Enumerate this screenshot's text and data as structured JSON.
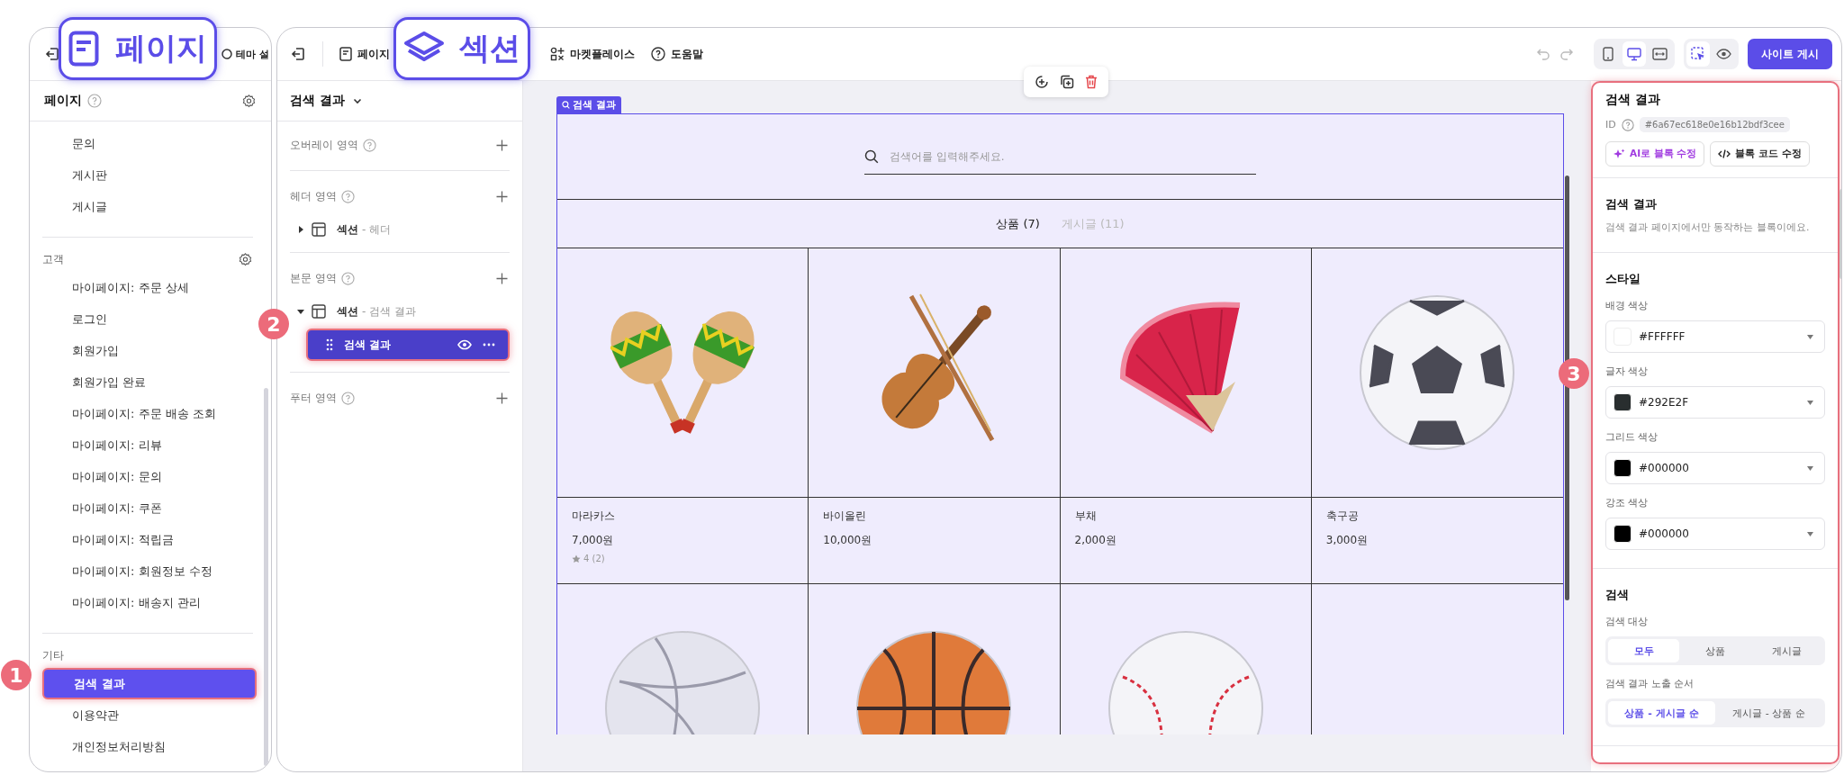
{
  "callouts": [
    {
      "kind": "page",
      "label": "페이지"
    },
    {
      "kind": "layers",
      "label": "섹션"
    }
  ],
  "markers": [
    "1",
    "2",
    "3"
  ],
  "pages_panel": {
    "toolbar_text": "테마 설",
    "title": "페이지",
    "groups": [
      {
        "items": [
          {
            "label": "문의",
            "selected": false
          },
          {
            "label": "게시판",
            "selected": false
          },
          {
            "label": "게시글",
            "selected": false
          }
        ]
      },
      {
        "title": "고객",
        "has_settings": true,
        "items": [
          {
            "label": "마이페이지: 주문 상세",
            "selected": false
          },
          {
            "label": "로그인",
            "selected": false
          },
          {
            "label": "회원가입",
            "selected": false
          },
          {
            "label": "회원가입 완료",
            "selected": false
          },
          {
            "label": "마이페이지: 주문 배송 조회",
            "selected": false
          },
          {
            "label": "마이페이지: 리뷰",
            "selected": false
          },
          {
            "label": "마이페이지: 문의",
            "selected": false
          },
          {
            "label": "마이페이지: 쿠폰",
            "selected": false
          },
          {
            "label": "마이페이지: 적립금",
            "selected": false
          },
          {
            "label": "마이페이지: 회원정보 수정",
            "selected": false
          },
          {
            "label": "마이페이지: 배송지 관리",
            "selected": false
          }
        ]
      },
      {
        "title": "기타",
        "has_settings": false,
        "items": [
          {
            "label": "검색 결과",
            "selected": true
          },
          {
            "label": "이용약관",
            "selected": false
          },
          {
            "label": "개인정보처리방침",
            "selected": false
          }
        ]
      }
    ]
  },
  "toolbar": {
    "items": [
      {
        "kind": "page",
        "label": "페이지"
      },
      {
        "kind": "market",
        "label": "마켓플레이스"
      },
      {
        "kind": "help",
        "label": "도움말"
      }
    ],
    "devices": [
      {
        "kind": "mobile",
        "selected": false
      },
      {
        "kind": "desktop",
        "selected": true
      },
      {
        "kind": "wide",
        "selected": false
      }
    ],
    "modes": [
      {
        "kind": "select",
        "selected": true
      },
      {
        "kind": "preview",
        "selected": false
      }
    ],
    "publish": "사이트 게시"
  },
  "sections_panel": {
    "title": "검색 결과",
    "areas": [
      {
        "label": "오버레이 영역"
      },
      {
        "label": "헤더 영역",
        "sections": [
          {
            "name": "섹션",
            "suffix": "- 헤더",
            "expanded": false
          }
        ]
      },
      {
        "label": "본문 영역",
        "sections": [
          {
            "name": "섹션",
            "suffix": "- 검색 결과",
            "expanded": true,
            "blocks": [
              {
                "label": "검색 결과",
                "selected": true
              }
            ]
          }
        ]
      },
      {
        "label": "푸터 영역"
      }
    ]
  },
  "canvas": {
    "block_tag": "검색 결과",
    "search_placeholder": "검색어를 입력해주세요.",
    "tabs": [
      {
        "label": "상품 (7)",
        "selected": true
      },
      {
        "label": "게시글 (11)",
        "selected": false
      }
    ],
    "products": [
      {
        "kind": "maracas",
        "name": "마라카스",
        "price": "7,000원",
        "rating": "4 (2)"
      },
      {
        "kind": "violin",
        "name": "바이올린",
        "price": "10,000원"
      },
      {
        "kind": "fan",
        "name": "부채",
        "price": "2,000원"
      },
      {
        "kind": "soccer",
        "name": "축구공",
        "price": "3,000원"
      },
      {
        "kind": "volleyball"
      },
      {
        "kind": "basketball"
      },
      {
        "kind": "baseball"
      }
    ]
  },
  "inspector": {
    "title": "검색 결과",
    "id_label": "ID",
    "id": "#6a67ec618e0e16b12bdf3cee",
    "buttons": [
      {
        "kind": "ai",
        "label": "AI로 블록 수정"
      },
      {
        "kind": "code",
        "label": "블록 코드 수정"
      }
    ],
    "block_title": "검색 결과",
    "description": "검색 결과 페이지에서만 동작하는 블록이에요.",
    "style_title": "스타일",
    "colors": [
      {
        "label": "배경 색상",
        "value": "#FFFFFF"
      },
      {
        "label": "글자 색상",
        "value": "#292E2F"
      },
      {
        "label": "그리드 색상",
        "value": "#000000"
      },
      {
        "label": "강조 색상",
        "value": "#000000"
      }
    ],
    "search_title": "검색",
    "segments": [
      {
        "label": "검색 대상",
        "options": [
          {
            "label": "모두",
            "selected": true
          },
          {
            "label": "상품",
            "selected": false
          },
          {
            "label": "게시글",
            "selected": false
          }
        ]
      },
      {
        "label": "검색 결과 노출 순서",
        "options": [
          {
            "label": "상품 - 게시글 순",
            "selected": true
          },
          {
            "label": "게시글 - 상품 순",
            "selected": false
          }
        ]
      }
    ]
  }
}
